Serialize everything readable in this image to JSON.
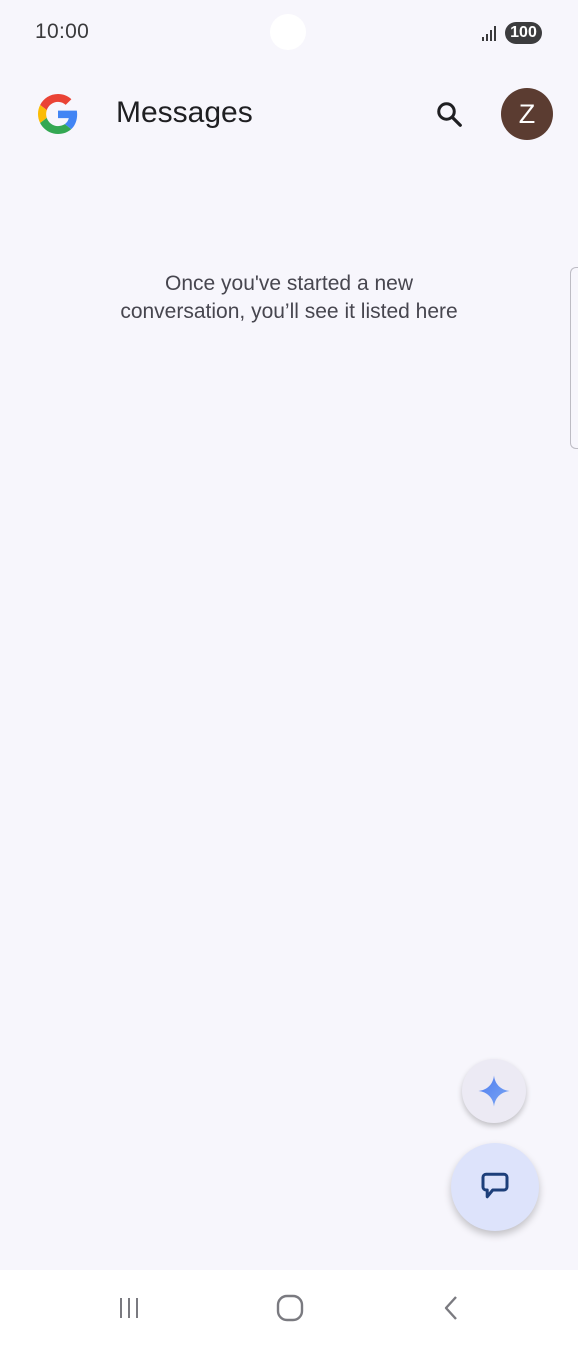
{
  "status_bar": {
    "time": "10:00",
    "battery": "100",
    "icons": [
      "signal-icon",
      "battery-icon"
    ]
  },
  "app_bar": {
    "logo": "google-logo",
    "title": "Messages",
    "search_icon": "search-icon",
    "avatar_initial": "Z",
    "avatar_color": "#5b3c31"
  },
  "empty_state": {
    "line1": "Once you've started a new",
    "line2": "conversation, you’ll see it listed here"
  },
  "fabs": {
    "gemini_icon": "sparkle-icon",
    "compose_icon": "chat-bubble-icon",
    "compose_color": "#dde3fb"
  },
  "nav_bar": {
    "icons": [
      "recents-icon",
      "home-icon",
      "back-icon"
    ]
  },
  "colors": {
    "background": "#f7f6fc",
    "text_primary": "#1f1f22",
    "text_secondary": "#47464f"
  }
}
